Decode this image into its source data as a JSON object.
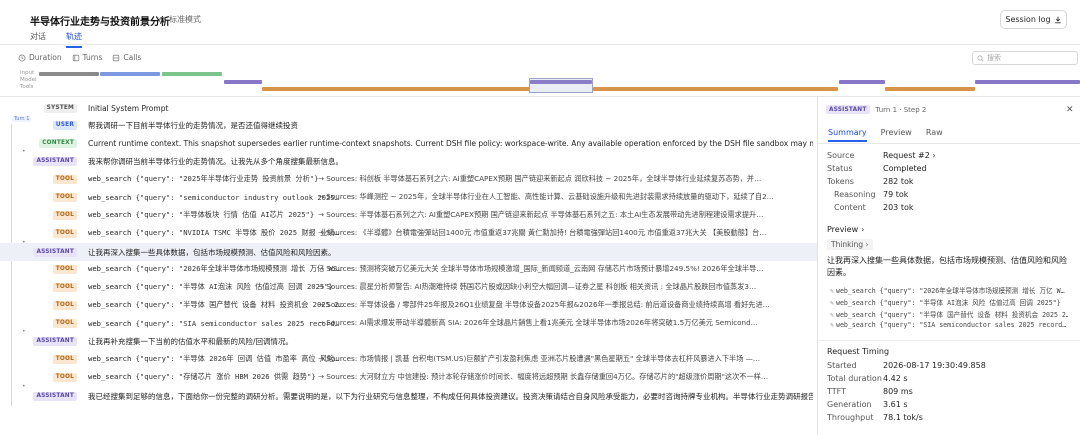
{
  "header": {
    "title": "半导体行业走势与投资前景分析",
    "mode_label": "标准模式",
    "session_log_label": "Session log",
    "tabs": [
      "对话",
      "轨迹"
    ]
  },
  "toolbar": {
    "duration_label": "Duration",
    "turns_label": "Turns",
    "calls_label": "Calls",
    "search_placeholder": "搜索"
  },
  "timeline": {
    "labels": [
      "Input",
      "Model",
      "Tools"
    ]
  },
  "turn_marker": "Turn 1",
  "rows": [
    {
      "role": "SYSTEM",
      "text": "Initial System Prompt"
    },
    {
      "role": "USER",
      "text": "帮我调研一下目前半导体行业的走势情况，是否还值得继续投资"
    },
    {
      "role": "CONTEXT",
      "text": "Current runtime context. This snapshot supersedes earlier runtime-context snapshots. Current DSH file policy: workspace-write. Any available operation enforced by the DSH file sandbox may modify files under t…"
    },
    {
      "role": "ASSISTANT",
      "text": "我来帮你调研当前半导体行业的走势情况。让我先从多个角度搜集最新信息。"
    },
    {
      "role": "TOOL",
      "name": "web_search",
      "args": "{\"query\": \"2025年半导体行业走势 投资前景 分析\"}",
      "result": "→ Sources: 科创板 半导体基石系列之六: AI重塑CAPEX预期 国产链迎来新起点  润欣科技 ~ 2025年，全球半导体行业延续复苏态势，并…"
    },
    {
      "role": "TOOL",
      "name": "web_search",
      "args": "{\"query\": \"semiconductor industry outlook 2025…",
      "result": "→ Sources: 华峰测控 ~ 2025年，全球半导体行业在人工智能、高性能计算、云基础设施升级和先进封装需求持续放量的驱动下，延续了自2…"
    },
    {
      "role": "TOOL",
      "name": "web_search",
      "args": "{\"query\": \"半导体板块 行情 估值 AI芯片 2025\"}",
      "result": "→ Sources: 半导体基石系列之六: AI重塑CAPEX预期 国产链迎来新起点 半导体基石系列之五: 本土AI生态发展带动先进制程建设需求提升…"
    },
    {
      "role": "TOOL",
      "name": "web_search",
      "args": "{\"query\": \"NVIDIA TSMC 半导体 股价 2025 财报 业绩…",
      "result": "→ Sources: 《半導體》台積電強彈站回1400元 市值重返37兆關 黃仁勳加持! 台積電強彈站回1400元 市值重返37兆大关 【美股動態】台…"
    },
    {
      "role": "ASSISTANT",
      "text": "让我再深入搜集一些具体数据，包括市场规模预测、估值风险和风险因素。"
    },
    {
      "role": "TOOL",
      "name": "web_search",
      "args": "{\"query\": \"2026年全球半导体市场规模预测 增长 万亿 WS…",
      "result": "→ Sources: 预测将突破万亿美元大关  全球半导体市场规模激增_国际_新闻频道_云南网  存储芯片市场预计暴增249.5%! 2026年全球半导…"
    },
    {
      "role": "TOOL",
      "name": "web_search",
      "args": "{\"query\": \"半导体 AI泡沫 风险 估值过高 回调 2025\"}",
      "result": "→ Sources: 晨星分析师警告: AI热潮难持续 韩国芯片股或因缺小利空大幅回调—证券之星 科创板 相关资讯 : 全球晶片股跌回市值蒸发3…"
    },
    {
      "role": "TOOL",
      "name": "web_search",
      "args": "{\"query\": \"半导体 国产替代 设备 材料 投资机会 2025 2…",
      "result": "→ Sources: 半导体设备 / 零部件25年报及26Q1业绩复盘 半导体设备2025年报&2026年一季报总结: 前后道设备商业绩持续高增 看好先进…"
    },
    {
      "role": "TOOL",
      "name": "web_search",
      "args": "{\"query\": \"SIA semiconductor sales 2025 record…",
      "result": "→ Sources: AI需求爆发带动半導體新高  SIA: 2026年全球晶片銷售上看1兆美元 全球半导体市场2026年将突破1.5万亿美元 Semicond…"
    },
    {
      "role": "ASSISTANT",
      "text": "让我再补充搜集一下当前的估值水平和最新的风险/回调情况。"
    },
    {
      "role": "TOOL",
      "name": "web_search",
      "args": "{\"query\": \"半导体 2026年 回调 估值 市盈率 高位 风险…",
      "result": "→ Sources: 市场情报 | 凯基 台积电(TSM.US)巨额扩产引发盈利焦虑 亚洲芯片股遭遇\"黑色星期五\" 全球半导体去杠杆风暴进入下半场 —…"
    },
    {
      "role": "TOOL",
      "name": "web_search",
      "args": "{\"query\": \"存储芯片 涨价 HBM 2026 供需 趋势\"}",
      "result": "→ Sources: 大河财立方 中信建投: 预计本轮存储涨价时间长、幅度将远超预期 长鑫存储重回4万亿。存储芯片的\"超级涨价周期\"这次不一样…"
    },
    {
      "role": "ASSISTANT",
      "text": "我已经搜集到足够的信息，下面给你一份完整的调研分析。需要说明的是，以下为行业研究与信息整理，不构成任何具体投资建议。投资决策请结合自身风险承受能力，必要时咨询持牌专业机构。半导体行业走势调研报告 —…"
    }
  ],
  "panel": {
    "badge": "ASSISTANT",
    "title": "Turn 1 · Step 2",
    "tabs": [
      "Summary",
      "Preview",
      "Raw"
    ],
    "summary": [
      {
        "k": "Source",
        "v": "Request #2"
      },
      {
        "k": "Status",
        "v": "Completed"
      },
      {
        "k": "Tokens",
        "v": "282 tok"
      },
      {
        "k": "Reasoning",
        "v": "79 tok"
      },
      {
        "k": "Content",
        "v": "203 tok"
      }
    ],
    "preview_label": "Preview",
    "thinking_label": "Thinking",
    "message": "让我再深入搜集一些具体数据，包括市场规模预测、估值风险和风险因素。",
    "tool_calls": [
      "web_search {\"query\": \"2026年全球半导体市场规模预测 增长 万亿 W…",
      "web_search {\"query\": \"半导体 AI泡沫 风险 估值过高 回调 2025\"}",
      "web_search {\"query\": \"半导体 国产替代 设备 材料 投资机会 2025 2…",
      "web_search {\"query\": \"SIA semiconductor sales 2025 record…"
    ],
    "timing_label": "Request Timing",
    "timing": [
      {
        "k": "Started",
        "v": "2026-08-17 19:30:49.858"
      },
      {
        "k": "Total duration",
        "v": "4.42 s"
      },
      {
        "k": "TTFT",
        "v": "809 ms"
      },
      {
        "k": "Generation",
        "v": "3.61 s"
      },
      {
        "k": "Throughput",
        "v": "78.1 tok/s"
      }
    ]
  },
  "colors": {
    "accent": "#2563eb",
    "input_grey": "#8a8a8a",
    "input_blue": "#7b98e0",
    "input_green": "#7cc58a",
    "model_purple": "#8a76c9",
    "tools_orange": "#d8954a"
  }
}
